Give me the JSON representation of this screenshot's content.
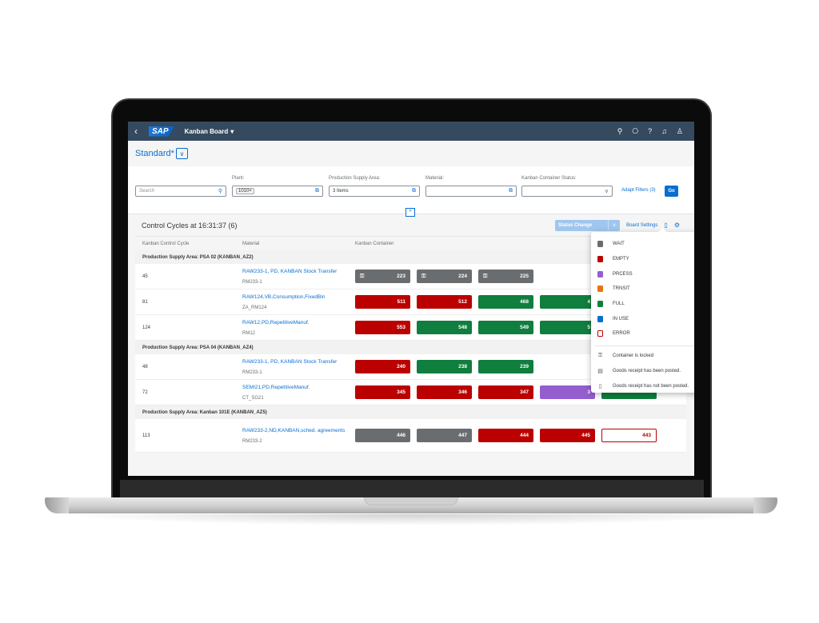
{
  "shell": {
    "back_icon": "‹",
    "logo_text": "SAP",
    "app_title": "Kanban Board",
    "app_title_caret": "▾",
    "actions": [
      {
        "name": "search-icon",
        "glyph": "⚲"
      },
      {
        "name": "copilot-icon",
        "glyph": "⎔"
      },
      {
        "name": "help-icon",
        "glyph": "?"
      },
      {
        "name": "notifications-icon",
        "glyph": "♫"
      },
      {
        "name": "user-icon",
        "glyph": "♙"
      }
    ]
  },
  "variant": {
    "title": "Standard*",
    "chevron": "∨"
  },
  "filters": {
    "search": {
      "placeholder": "Search",
      "icon": "⚲"
    },
    "plant": {
      "label": "Plant:",
      "token": "1010",
      "token_remove": "×",
      "icon": "⧉"
    },
    "psa": {
      "label": "Production Supply Area:",
      "value": "3 Items",
      "icon": "⧉"
    },
    "material": {
      "label": "Material:",
      "value": "",
      "icon": "⧉"
    },
    "status": {
      "label": "Kanban Container Status:",
      "value": "",
      "icon": "∨"
    },
    "adapt_filters": "Adapt Filters (3)",
    "go": "Go",
    "collapse_icon": "^"
  },
  "table": {
    "title": "Control Cycles at 16:31:37 (6)",
    "status_change": "Status Change",
    "status_change_caret": "∨",
    "board_settings": "Board Settings",
    "legend_icon": "▯",
    "settings_icon": "⚙",
    "columns": [
      "Kanban Control Cycle",
      "Material",
      "Kanban Container"
    ],
    "lock_glyph": "🔒",
    "groups": [
      {
        "title": "Production Supply Area: PSA 02 (KANBAN_AZ2)",
        "rows": [
          {
            "cycle": "45",
            "material": "RAW233-1, PD, KANBAN Stock Transfer",
            "material_id": "RM233-1",
            "containers": [
              {
                "num": "223",
                "status": "WAIT",
                "locked": true
              },
              {
                "num": "224",
                "status": "WAIT",
                "locked": true
              },
              {
                "num": "225",
                "status": "WAIT",
                "locked": true
              }
            ]
          },
          {
            "cycle": "81",
            "material": "RAW124,VB,Consumption,FixedBin",
            "material_id": "ZA_RM124",
            "containers": [
              {
                "num": "511",
                "status": "EMPTY",
                "locked": false
              },
              {
                "num": "512",
                "status": "EMPTY",
                "locked": false
              },
              {
                "num": "468",
                "status": "FULL",
                "locked": false
              },
              {
                "num": "4",
                "status": "FULL",
                "locked": false
              }
            ]
          },
          {
            "cycle": "124",
            "material": "RAW12,PD,RepetitiveManuf.",
            "material_id": "RM12",
            "containers": [
              {
                "num": "553",
                "status": "EMPTY",
                "locked": false
              },
              {
                "num": "548",
                "status": "FULL",
                "locked": false
              },
              {
                "num": "549",
                "status": "FULL",
                "locked": false
              },
              {
                "num": "5",
                "status": "FULL",
                "locked": false
              }
            ]
          }
        ]
      },
      {
        "title": "Production Supply Area: PSA 04 (KANBAN_AZ4)",
        "rows": [
          {
            "cycle": "48",
            "material": "RAW233-1, PD, KANBAN Stock Transfer",
            "material_id": "RM233-1",
            "containers": [
              {
                "num": "240",
                "status": "EMPTY",
                "locked": false
              },
              {
                "num": "238",
                "status": "FULL",
                "locked": false
              },
              {
                "num": "239",
                "status": "FULL",
                "locked": false
              }
            ]
          },
          {
            "cycle": "72",
            "material": "SEMI21,PD,RepetitiveManuf.",
            "material_id": "CT_SG21",
            "containers": [
              {
                "num": "345",
                "status": "EMPTY",
                "locked": false
              },
              {
                "num": "346",
                "status": "EMPTY",
                "locked": false
              },
              {
                "num": "347",
                "status": "EMPTY",
                "locked": false
              },
              {
                "num": "3",
                "status": "PROCESS",
                "locked": false
              },
              {
                "num": "",
                "status": "FULL",
                "locked": false
              }
            ]
          }
        ]
      },
      {
        "title": "Production Supply Area: Kanban 101E (KANBAN_AZ5)",
        "rows": [
          {
            "cycle": "113",
            "material": "RAW233-2,ND,KANBAN,sched. agreements",
            "material_id": "RM233-2",
            "tall": true,
            "containers": [
              {
                "num": "446",
                "status": "WAIT",
                "locked": false
              },
              {
                "num": "447",
                "status": "WAIT",
                "locked": false
              },
              {
                "num": "444",
                "status": "EMPTY",
                "locked": false
              },
              {
                "num": "445",
                "status": "EMPTY",
                "locked": false
              },
              {
                "num": "443",
                "status": "ERROR",
                "locked": false
              }
            ]
          }
        ]
      }
    ]
  },
  "legend": {
    "statuses": [
      {
        "label": "WAIT",
        "status": "WAIT",
        "color": "#6a6d70"
      },
      {
        "label": "EMPTY",
        "status": "EMPTY",
        "color": "#bb0000"
      },
      {
        "label": "PRCESS",
        "status": "PROCESS",
        "color": "#945ecf"
      },
      {
        "label": "TRNSIT",
        "status": "TRANSIT",
        "color": "#e9730c"
      },
      {
        "label": "FULL",
        "status": "FULL",
        "color": "#107e3e"
      },
      {
        "label": "IN USE",
        "status": "INUSE",
        "color": "#0a6ed1"
      },
      {
        "label": "ERROR",
        "status": "ERROR",
        "color": "#bb0000"
      }
    ],
    "icons": [
      {
        "label": "Container is locked",
        "icon": "lock-icon",
        "glyph": "🔒"
      },
      {
        "label": "Goods receipt has been posted.",
        "icon": "document-posted-icon",
        "glyph": "🗎"
      },
      {
        "label": "Goods receipt has not been posted.",
        "icon": "document-not-posted-icon",
        "glyph": "🗋"
      }
    ]
  }
}
